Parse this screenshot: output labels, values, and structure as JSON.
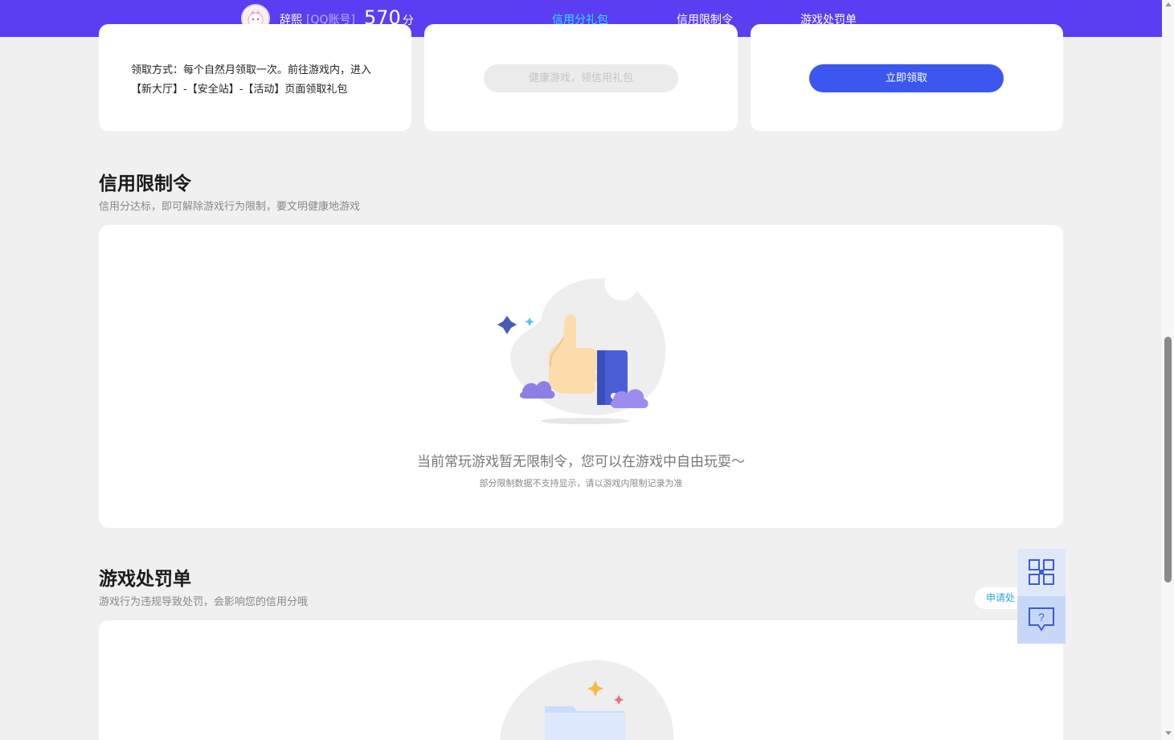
{
  "header": {
    "user_name": "辞熙",
    "account_type": "[QQ账号]",
    "score": "570",
    "score_unit": "分",
    "nav": [
      {
        "label": "信用分礼包",
        "active": true
      },
      {
        "label": "信用限制令",
        "active": false
      },
      {
        "label": "游戏处罚单",
        "active": false
      }
    ],
    "accent_color": "#5b3df2",
    "active_color": "#2ce3ff"
  },
  "gift_cards": {
    "claim_method": "领取方式：每个自然月领取一次。前往游戏内，进入【新大厅】-【安全站】-【活动】页面领取礼包",
    "disabled_button": "健康游戏，领信用礼包",
    "claim_button": "立即领取"
  },
  "restriction": {
    "title": "信用限制令",
    "subtitle": "信用分达标，即可解除游戏行为限制，要文明健康地游戏",
    "empty_text": "当前常玩游戏暂无限制令，您可以在游戏中自由玩耍～",
    "empty_note": "部分限制数据不支持显示，请以游戏内限制记录为准"
  },
  "penalty": {
    "title": "游戏处罚单",
    "subtitle": "游戏行为违规导致处罚，会影响您的信用分哦",
    "apply_button": "申请处"
  },
  "sidebar": {
    "qr_icon": "qr-code-icon",
    "help_icon": "help-chat-icon"
  }
}
